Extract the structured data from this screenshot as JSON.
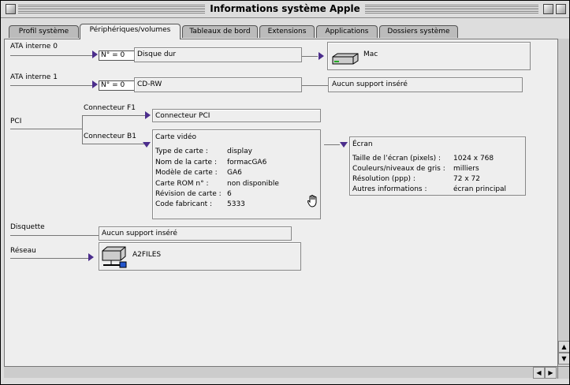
{
  "window": {
    "title": "Informations système Apple"
  },
  "tabs": [
    {
      "label": "Profil système"
    },
    {
      "label": "Périphériques/volumes"
    },
    {
      "label": "Tableaux de bord"
    },
    {
      "label": "Extensions"
    },
    {
      "label": "Applications"
    },
    {
      "label": "Dossiers système"
    }
  ],
  "active_tab": "Périphériques/volumes",
  "ata0": {
    "label": "ATA interne 0",
    "id": "N° = 0",
    "device": "Disque dur",
    "volume": "Mac"
  },
  "ata1": {
    "label": "ATA interne 1",
    "id": "N° = 0",
    "device": "CD-RW",
    "media": "Aucun support inséré"
  },
  "pci": {
    "label": "PCI",
    "f1": {
      "label": "Connecteur F1",
      "content": "Connecteur PCI"
    },
    "b1": {
      "label": "Connecteur B1",
      "card": {
        "title": "Carte vidéo",
        "rows": [
          {
            "key": "Type de carte :",
            "val": "display"
          },
          {
            "key": "Nom de la carte :",
            "val": "formacGA6"
          },
          {
            "key": "Modèle de carte :",
            "val": "GA6"
          },
          {
            "key": "Carte ROM n° :",
            "val": "non disponible"
          },
          {
            "key": "Révision de carte :",
            "val": "6"
          },
          {
            "key": "Code fabricant :",
            "val": "5333"
          }
        ]
      },
      "screen": {
        "title": "Écran",
        "rows": [
          {
            "key": "Taille de l’écran (pixels) :",
            "val": "1024 x 768"
          },
          {
            "key": "Couleurs/niveaux de gris :",
            "val": "milliers"
          },
          {
            "key": "Résolution (ppp) :",
            "val": "72 x 72"
          },
          {
            "key": "Autres informations :",
            "val": "écran principal"
          }
        ]
      }
    }
  },
  "floppy": {
    "label": "Disquette",
    "media": "Aucun support inséré"
  },
  "network": {
    "label": "Réseau",
    "volume": "A2FILES"
  },
  "icons": {
    "hard-disk": "hard-disk-icon",
    "network-volume": "network-volume-icon",
    "pointer": "hand-cursor-icon"
  },
  "colors": {
    "disclosure": "#4b2d8c",
    "window_bg": "#dddddd",
    "pane_bg": "#eeeeee"
  }
}
